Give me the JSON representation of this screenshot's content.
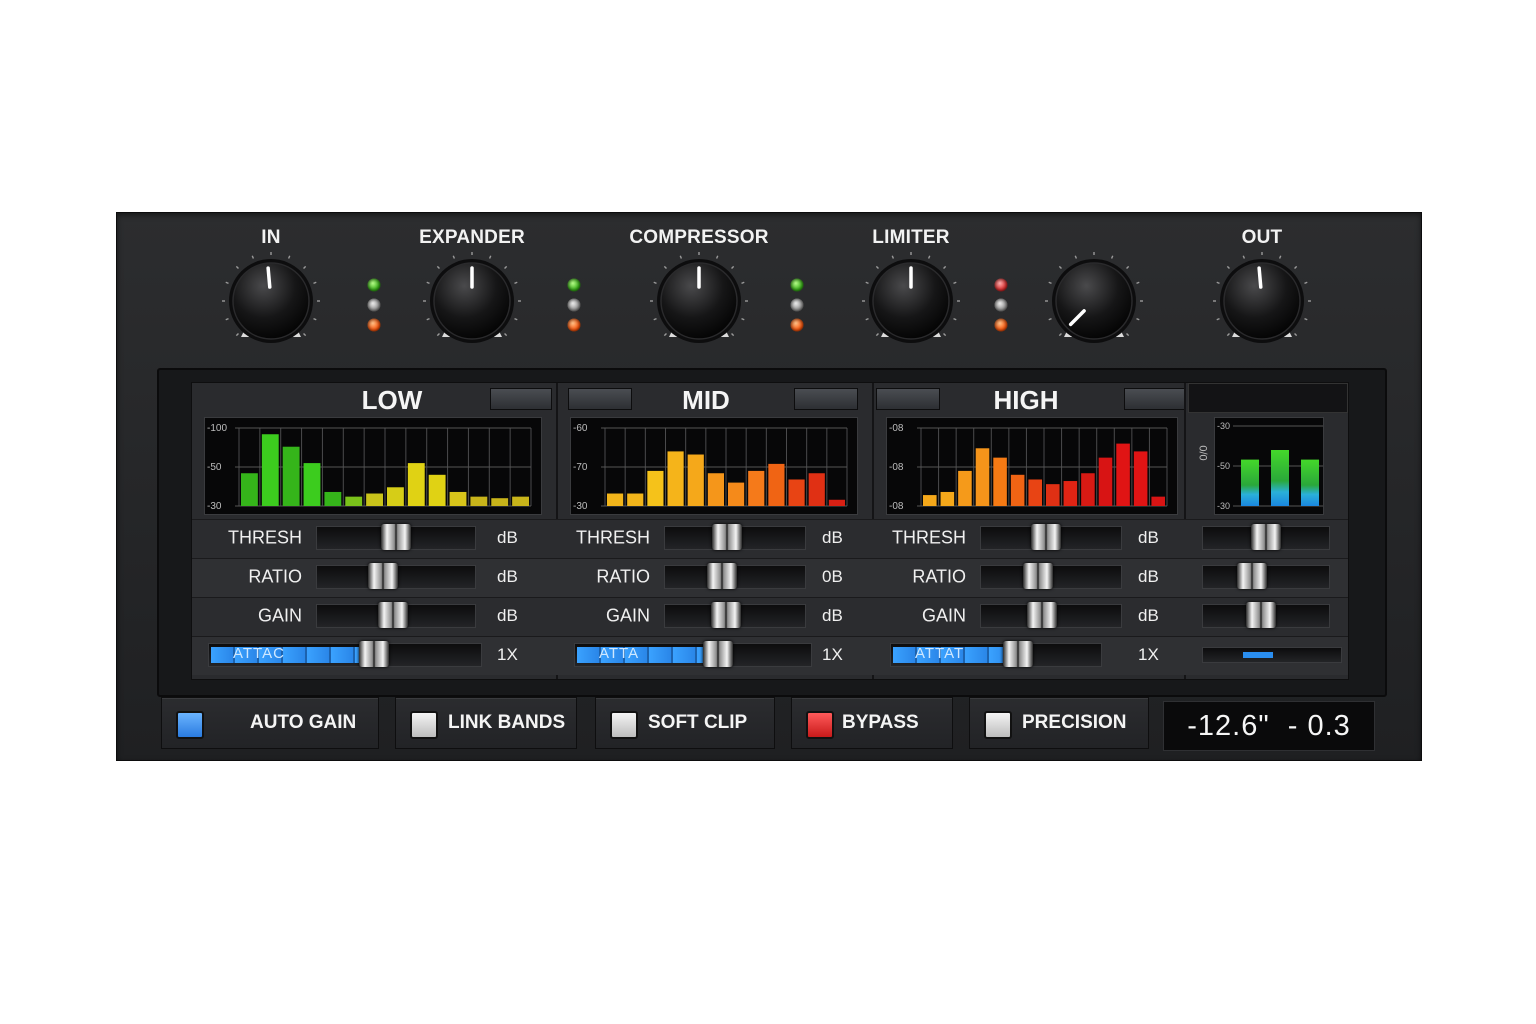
{
  "knobs": [
    {
      "label": "IN",
      "angle": -5
    },
    {
      "label": "EXPANDER",
      "angle": 0
    },
    {
      "label": "COMPRESSOR",
      "angle": 0
    },
    {
      "label": "LIMITER",
      "angle": 0
    },
    {
      "label": "",
      "angle": 225
    },
    {
      "label": "OUT",
      "angle": -5
    }
  ],
  "led_groups": [
    [
      "green",
      "grey",
      "orange"
    ],
    [
      "green",
      "grey",
      "orange"
    ],
    [
      "green",
      "grey",
      "orange"
    ],
    [
      "red",
      "grey",
      "orange"
    ]
  ],
  "bands": [
    {
      "name": "LOW",
      "scale": [
        "-100",
        "-50",
        "-30"
      ],
      "bars": [
        {
          "level": 0.42,
          "color": "#35b51a"
        },
        {
          "level": 0.92,
          "color": "#3ccc1e"
        },
        {
          "level": 0.76,
          "color": "#35b51a"
        },
        {
          "level": 0.55,
          "color": "#3ccc1e"
        },
        {
          "level": 0.18,
          "color": "#35b51a"
        },
        {
          "level": 0.12,
          "color": "#7ac11a"
        },
        {
          "level": 0.16,
          "color": "#c9c31a"
        },
        {
          "level": 0.24,
          "color": "#d6cd17"
        },
        {
          "level": 0.55,
          "color": "#e0d214"
        },
        {
          "level": 0.4,
          "color": "#e0d214"
        },
        {
          "level": 0.18,
          "color": "#d8c41a"
        },
        {
          "level": 0.12,
          "color": "#c8b41a"
        },
        {
          "level": 0.1,
          "color": "#c8b41a"
        },
        {
          "level": 0.12,
          "color": "#c8b41a"
        }
      ],
      "params": {
        "thresh": "THRESH",
        "ratio": "RATIO",
        "gain": "GAIN",
        "unit_db": "dB",
        "unit_db2": "dB",
        "unit_db3": "dB",
        "attack": "ATTAC",
        "mult": "1X"
      },
      "slider_values": {
        "thresh": 0.5,
        "ratio": 0.4,
        "gain": 0.48,
        "attack": 0.62
      }
    },
    {
      "name": "MID",
      "scale": [
        "-60",
        "-70",
        "-30"
      ],
      "bars": [
        {
          "level": 0.16,
          "color": "#f2b51a"
        },
        {
          "level": 0.16,
          "color": "#f2b51a"
        },
        {
          "level": 0.45,
          "color": "#f5c21a"
        },
        {
          "level": 0.7,
          "color": "#f5b41a"
        },
        {
          "level": 0.66,
          "color": "#f5a81a"
        },
        {
          "level": 0.42,
          "color": "#f5961a"
        },
        {
          "level": 0.3,
          "color": "#f58a1a"
        },
        {
          "level": 0.45,
          "color": "#f57a1a"
        },
        {
          "level": 0.54,
          "color": "#f06414"
        },
        {
          "level": 0.34,
          "color": "#e84414"
        },
        {
          "level": 0.42,
          "color": "#e03014"
        },
        {
          "level": 0.08,
          "color": "#d82014"
        }
      ],
      "params": {
        "thresh": "THRESH",
        "ratio": "RATIO",
        "gain": "GAIN",
        "unit_db": "dB",
        "unit_db2": "0B",
        "unit_db3": "dB",
        "attack": "ATTA",
        "mult": "1X"
      },
      "slider_values": {
        "thresh": 0.43,
        "ratio": 0.38,
        "gain": 0.42,
        "attack": 0.62
      }
    },
    {
      "name": "HIGH",
      "scale": [
        "-08",
        "-08",
        "-08"
      ],
      "bars": [
        {
          "level": 0.14,
          "color": "#f5a81a"
        },
        {
          "level": 0.18,
          "color": "#f5a81a"
        },
        {
          "level": 0.45,
          "color": "#f59a1a"
        },
        {
          "level": 0.74,
          "color": "#f5941a"
        },
        {
          "level": 0.62,
          "color": "#f57a14"
        },
        {
          "level": 0.4,
          "color": "#f06414"
        },
        {
          "level": 0.34,
          "color": "#e84414"
        },
        {
          "level": 0.28,
          "color": "#e03014"
        },
        {
          "level": 0.32,
          "color": "#e02414"
        },
        {
          "level": 0.42,
          "color": "#d81a14"
        },
        {
          "level": 0.62,
          "color": "#d81414"
        },
        {
          "level": 0.8,
          "color": "#e01414"
        },
        {
          "level": 0.7,
          "color": "#e01414"
        },
        {
          "level": 0.12,
          "color": "#d81414"
        }
      ],
      "params": {
        "thresh": "THRESH",
        "ratio": "RATIO",
        "gain": "GAIN",
        "unit_db": "dB",
        "unit_db2": "dB",
        "unit_db3": "dB",
        "attack": "ATTAT",
        "mult": "1X"
      },
      "slider_values": {
        "thresh": 0.45,
        "ratio": 0.38,
        "gain": 0.42,
        "attack": 0.62
      }
    }
  ],
  "out_meter": {
    "scale": [
      "-30",
      "-50",
      "-30"
    ],
    "side_label": "0/0",
    "bars": [
      {
        "level": 0.58
      },
      {
        "level": 0.7
      },
      {
        "level": 0.58
      }
    ],
    "slider_values": {
      "thresh": 0.5,
      "ratio": 0.35,
      "gain": 0.45,
      "attack": 0.55
    }
  },
  "bottom_buttons": [
    {
      "label": "AUTO GAIN",
      "state": "blue"
    },
    {
      "label": "LINK BANDS",
      "state": "white"
    },
    {
      "label": "SOFT CLIP",
      "state": "white"
    },
    {
      "label": "BYPASS",
      "state": "red"
    },
    {
      "label": "PRECISION",
      "state": "white"
    }
  ],
  "readout": "-12.6\"  - 0.3"
}
